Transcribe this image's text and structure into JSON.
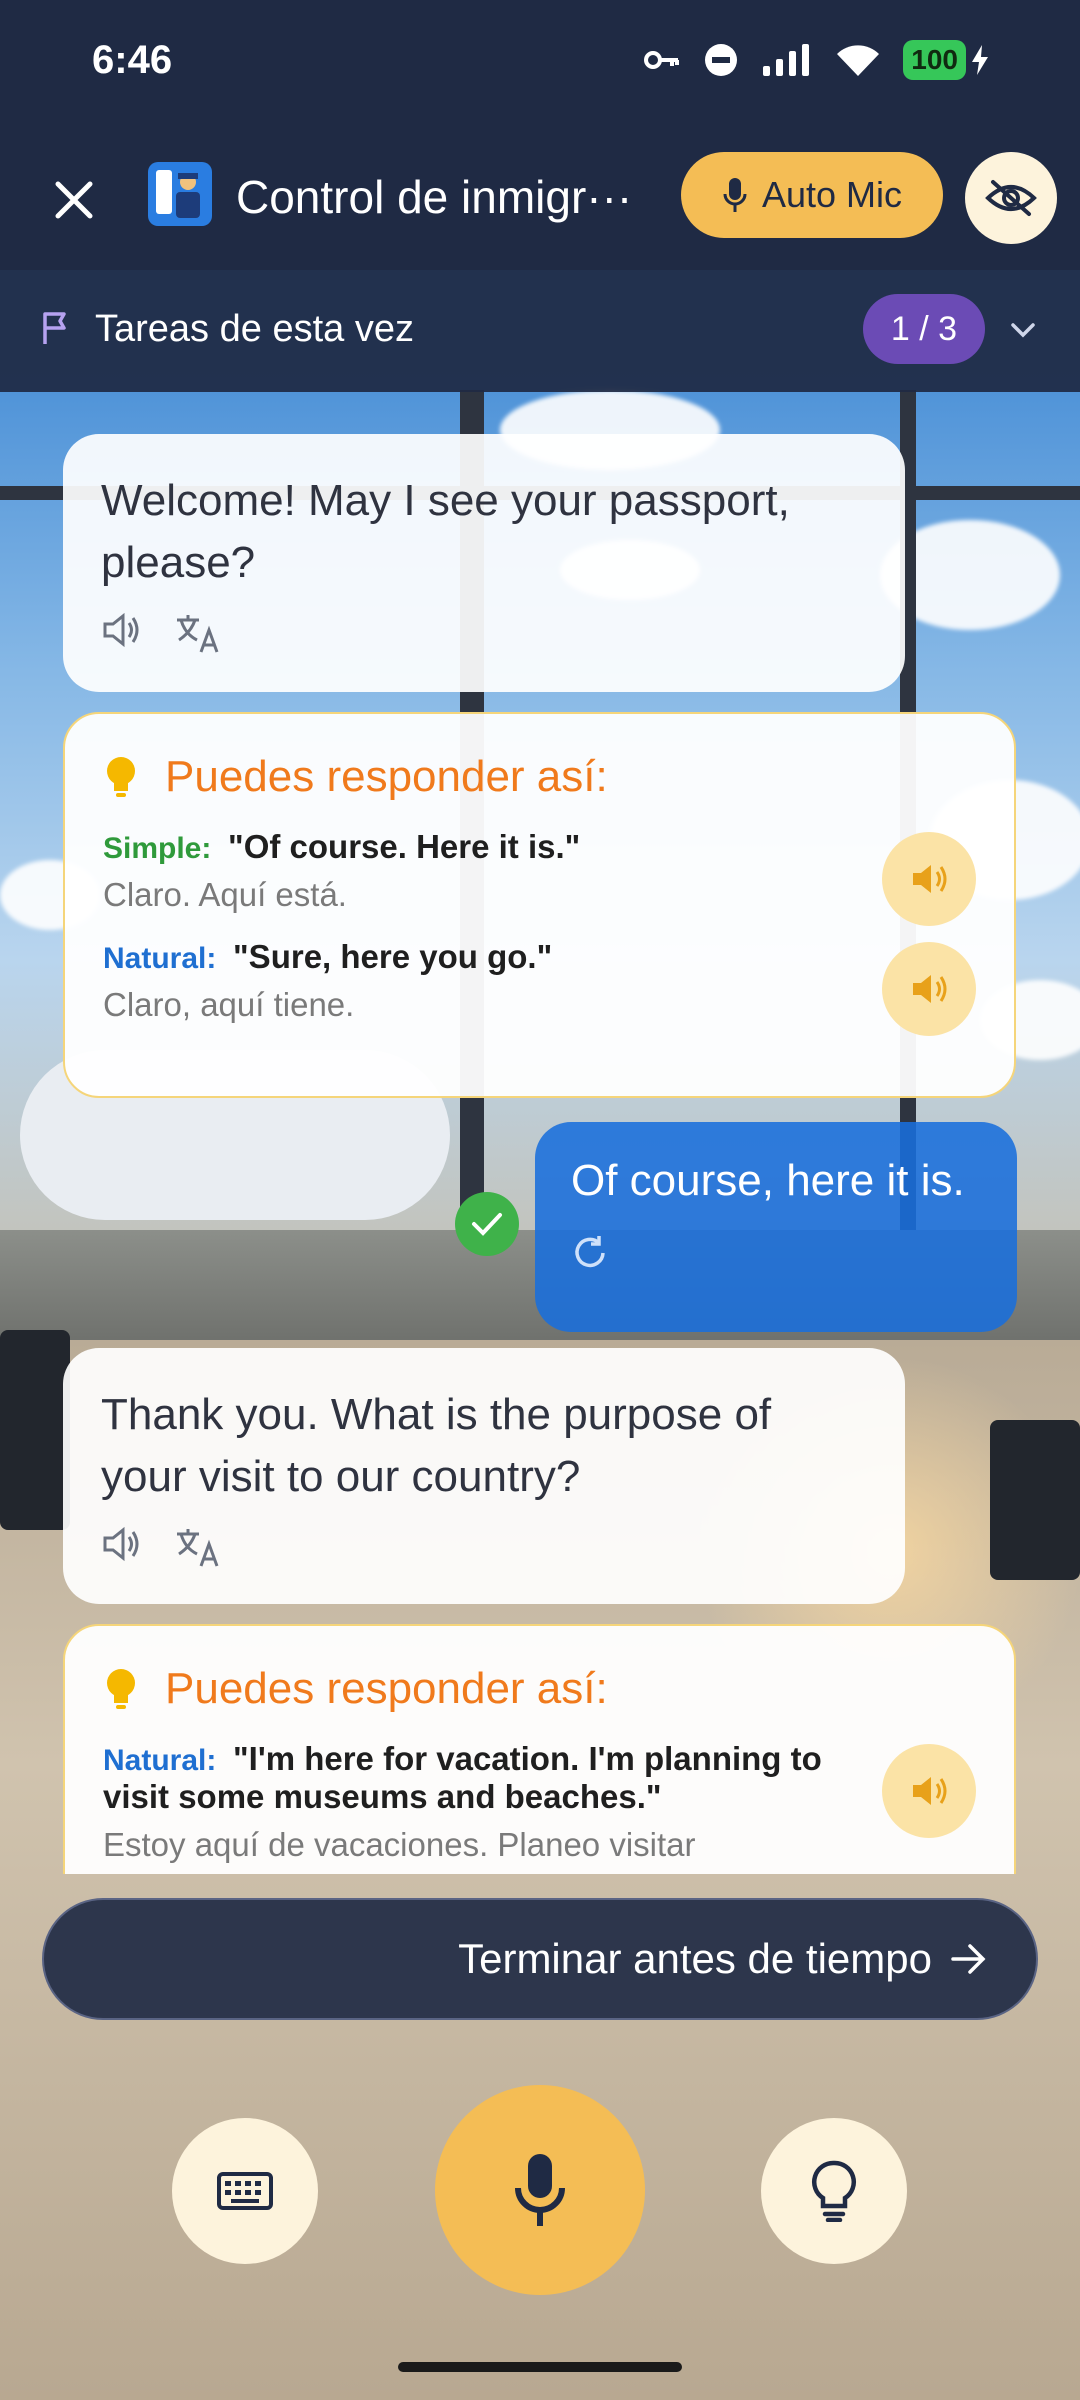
{
  "status_bar": {
    "time": "6:46",
    "battery": "100"
  },
  "header": {
    "title": "Control de inmigr···",
    "auto_mic_label": "Auto Mic"
  },
  "tasks": {
    "label": "Tareas de esta vez",
    "counter": "1 / 3"
  },
  "conversation": {
    "ai_message_1": "Welcome! May I see your passport, please?",
    "hint_1": {
      "title": "Puedes responder así:",
      "options": [
        {
          "label": "Simple",
          "english": "\"Of course. Here it is.\"",
          "spanish": "Claro. Aquí está."
        },
        {
          "label": "Natural",
          "english": "\"Sure, here you go.\"",
          "spanish": "Claro, aquí tiene."
        }
      ]
    },
    "user_message_1": "Of course, here it is.",
    "ai_message_2": "Thank you. What is the purpose of your visit to our country?",
    "hint_2": {
      "title": "Puedes responder así:",
      "options": [
        {
          "label": "Natural",
          "english": "\"I'm here for vacation. I'm planning to visit some museums and beaches.\"",
          "spanish": "Estoy aquí de vacaciones. Planeo visitar"
        }
      ]
    }
  },
  "finish_early_label": "Terminar antes de tiempo",
  "colors": {
    "accent": "#f4bd55",
    "header_bg": "#1f2a44",
    "user_bubble": "#196edc",
    "hint_title": "#f07a1c"
  }
}
